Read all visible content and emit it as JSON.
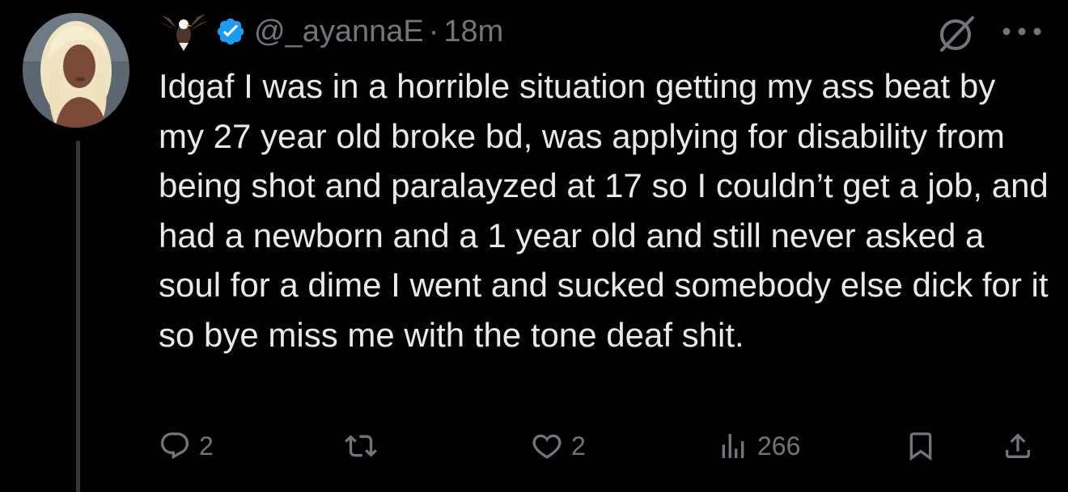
{
  "author": {
    "handle": "@_ayannaE",
    "separator": "·",
    "time": "18m",
    "name_emoji": "eagle-emoji",
    "verified_color": "#1d9bf0"
  },
  "tweet": {
    "text": "Idgaf I was in a horrible situation getting my ass beat by my 27 year old broke bd, was applying for disability from being shot and paralayzed at 17 so I couldn’t get a job, and had a newborn and a 1 year old and still never asked a soul for a dime I went and sucked somebody else dick for it so bye miss me with the tone deaf shit."
  },
  "actions": {
    "replies": "2",
    "reposts": "",
    "likes": "2",
    "views": "266"
  },
  "icons": {
    "top_right": [
      "grok-icon",
      "more-icon"
    ],
    "action_bar": [
      "reply-icon",
      "repost-icon",
      "like-icon",
      "views-icon",
      "bookmark-icon",
      "share-icon"
    ]
  },
  "colors": {
    "background": "#000000",
    "text": "#e7e9ea",
    "muted": "#71767b",
    "thread_line": "#333639",
    "accent": "#1d9bf0"
  }
}
